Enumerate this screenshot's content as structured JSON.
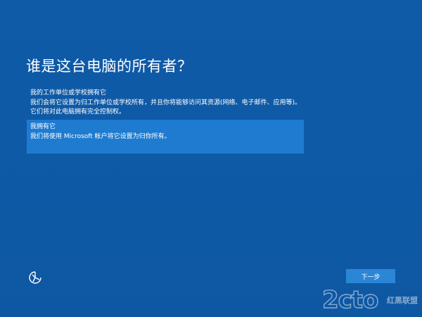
{
  "screen": {
    "title": "谁是这台电脑的所有者？"
  },
  "options": {
    "work": {
      "heading": "我的工作单位或学校拥有它",
      "line1": "我们会将它设置为归工作单位或学校所有，并且你将能够访问其资源(网络、电子邮件、应用等)。",
      "line2": "它们将对此电脑拥有完全控制权。"
    },
    "own": {
      "heading": "我拥有它",
      "line1": "我们将使用 Microsoft 帐户将它设置为归你所有。"
    }
  },
  "footer": {
    "next_label": "下一步",
    "accessibility_icon": "ease-of-access-icon"
  },
  "watermark": {
    "logo": "2cto",
    "sub": "红黑联盟"
  },
  "colors": {
    "background": "#0f5aa6",
    "selected_option": "#1f7bd0",
    "button": "#2b86d6"
  }
}
